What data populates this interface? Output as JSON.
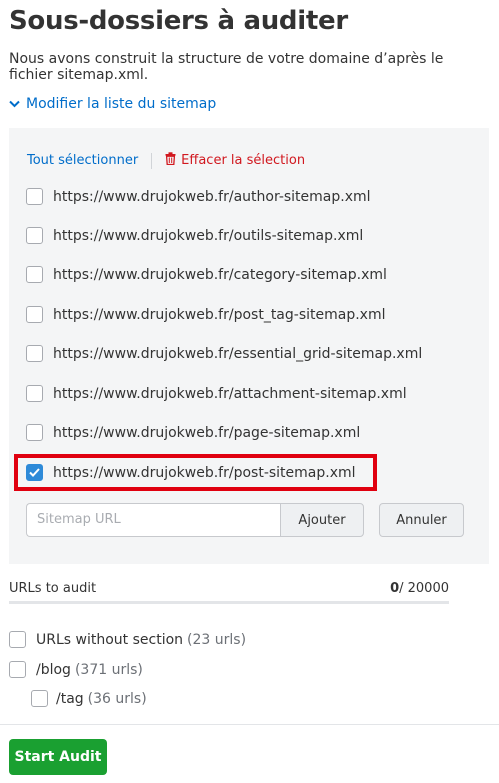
{
  "page": {
    "title": "Sous-dossiers à auditer",
    "intro": "Nous avons construit la structure de votre domaine d’après le fichier sitemap.xml.",
    "toggle_label": "Modifier la liste du sitemap"
  },
  "sitemap_panel": {
    "select_all_label": "Tout sélectionner",
    "clear_selection_label": "Effacer la sélection",
    "items": [
      {
        "url": "https://www.drujokweb.fr/author-sitemap.xml",
        "checked": false
      },
      {
        "url": "https://www.drujokweb.fr/outils-sitemap.xml",
        "checked": false
      },
      {
        "url": "https://www.drujokweb.fr/category-sitemap.xml",
        "checked": false
      },
      {
        "url": "https://www.drujokweb.fr/post_tag-sitemap.xml",
        "checked": false
      },
      {
        "url": "https://www.drujokweb.fr/essential_grid-sitemap.xml",
        "checked": false
      },
      {
        "url": "https://www.drujokweb.fr/attachment-sitemap.xml",
        "checked": false
      },
      {
        "url": "https://www.drujokweb.fr/page-sitemap.xml",
        "checked": false
      },
      {
        "url": "https://www.drujokweb.fr/post-sitemap.xml",
        "checked": true
      }
    ],
    "url_input_placeholder": "Sitemap URL",
    "add_label": "Ajouter",
    "cancel_label": "Annuler"
  },
  "audit": {
    "label": "URLs to audit",
    "count": "0",
    "limit": "/ 20000",
    "progress_fraction": 0
  },
  "sections": [
    {
      "name": "URLs without section",
      "count": "(23 urls)",
      "checked": false
    },
    {
      "name": "/blog",
      "count": "(371 urls)",
      "checked": false
    },
    {
      "name": "/tag",
      "count": "(36 urls)",
      "checked": false
    }
  ],
  "start_button_label": "Start Audit",
  "colors": {
    "link": "#006dca",
    "danger": "#d1181f",
    "checkbox_checked": "#2e8ad8",
    "highlight": "#e0000f",
    "start_button": "#1aa031"
  }
}
